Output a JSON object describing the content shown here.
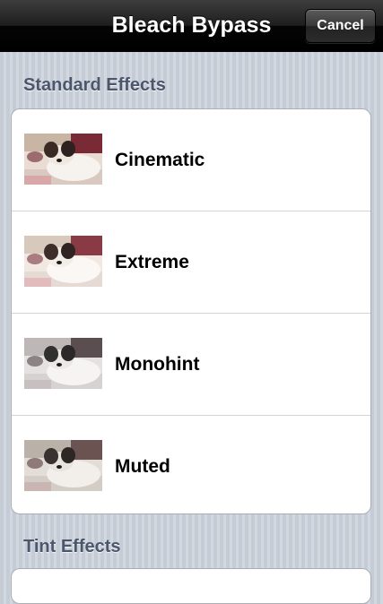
{
  "navbar": {
    "title": "Bleach Bypass",
    "cancel_label": "Cancel"
  },
  "sections": [
    {
      "header": "Standard Effects",
      "items": [
        {
          "label": "Cinematic",
          "thumbnail_icon": "dog-photo-thumbnail",
          "tone": "warm"
        },
        {
          "label": "Extreme",
          "thumbnail_icon": "dog-photo-thumbnail",
          "tone": "warm-light"
        },
        {
          "label": "Monohint",
          "thumbnail_icon": "dog-photo-thumbnail",
          "tone": "gray"
        },
        {
          "label": "Muted",
          "thumbnail_icon": "dog-photo-thumbnail",
          "tone": "muted"
        }
      ]
    },
    {
      "header": "Tint Effects",
      "items": []
    }
  ],
  "colors": {
    "navbar": "#000000",
    "section_header": "#4c566c",
    "background": "#cbd2db"
  }
}
